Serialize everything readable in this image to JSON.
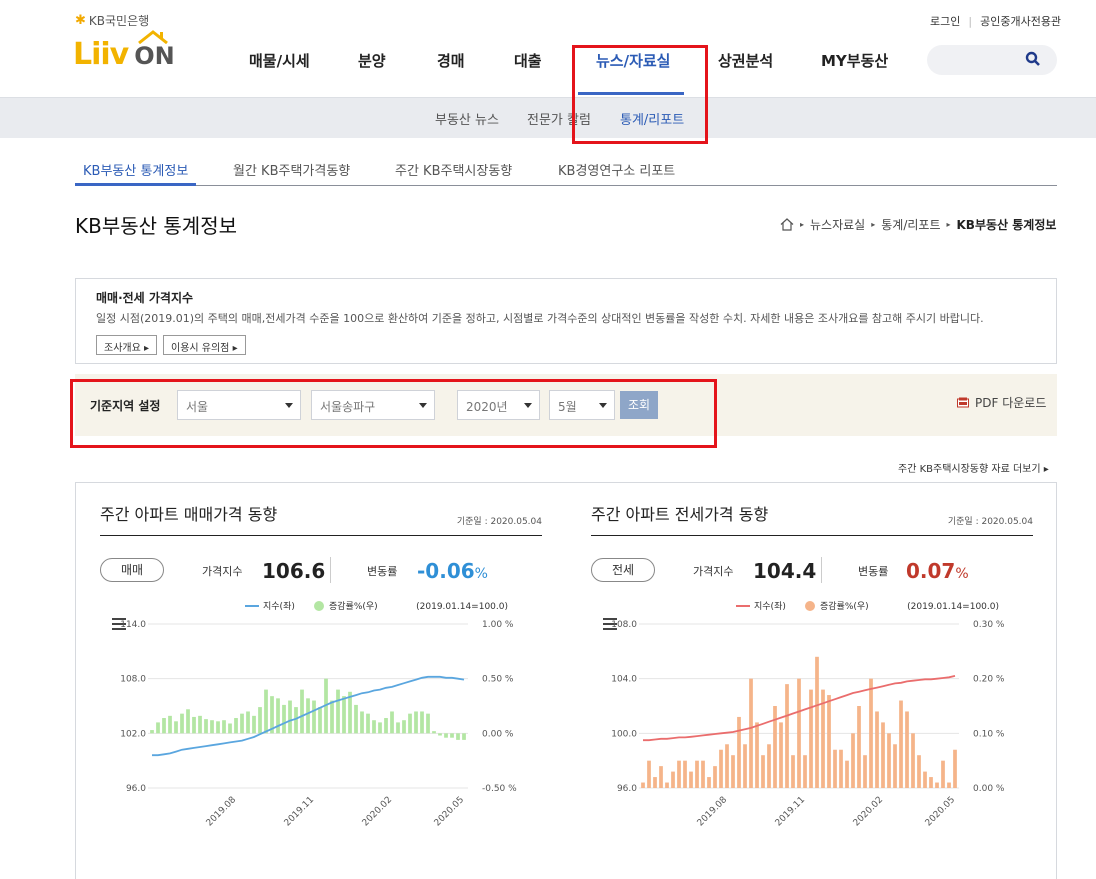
{
  "header": {
    "kb_brand": "KB국민은행",
    "logo_liiv": "Liiv",
    "logo_on": "ON",
    "login": "로그인",
    "agent_link": "공인중개사전용관",
    "nav": [
      "매물/시세",
      "분양",
      "경매",
      "대출",
      "뉴스/자료실",
      "상권분석",
      "MY부동산"
    ],
    "active_nav": "뉴스/자료실"
  },
  "subnav": {
    "items": [
      "부동산 뉴스",
      "전문가 칼럼",
      "통계/리포트"
    ],
    "active": "통계/리포트"
  },
  "tabs": {
    "items": [
      "KB부동산 통계정보",
      "월간 KB주택가격동향",
      "주간 KB주택시장동향",
      "KB경영연구소 리포트"
    ],
    "active": "KB부동산 통계정보"
  },
  "page_title": "KB부동산 통계정보",
  "breadcrumb": [
    "뉴스자료실",
    "통계/리포트",
    "KB부동산 통계정보"
  ],
  "info": {
    "title": "매매·전세 가격지수",
    "description": "일정 시점(2019.01)의 주택의 매매,전세가격 수준을 100으로 환산하여 기준을 정하고, 시점별로 가격수준의 상대적인 변동률을 작성한 수치. 자세한 내용은 조사개요를 참고해 주시기 바랍니다.",
    "btn_survey": "조사개요",
    "btn_notice": "이용시 유의점"
  },
  "filter": {
    "label": "기준지역 설정",
    "region": "서울",
    "district": "서울송파구",
    "year": "2020년",
    "month": "5월",
    "search_btn": "조회",
    "pdf": "PDF 다운로드"
  },
  "more_link": "주간 KB주택시장동향 자료 더보기",
  "colors": {
    "sale_line": "#5aa6df",
    "sale_bar": "#b3e6a3",
    "jeonse_line": "#ea6d6d",
    "jeonse_bar": "#f5b48a",
    "down": "#2f8fd6",
    "up": "#c0392b"
  },
  "sale": {
    "title": "주간 아파트 매매가격 동향",
    "date": "기준일 : 2020.05.04",
    "pill": "매매",
    "index_label": "가격지수",
    "index_value": "106.6",
    "rate_label": "변동률",
    "rate_value": "-0.06",
    "rate_unit": "%",
    "base_note": "(2019.01.14=100.0)",
    "legend_line": "지수(좌)",
    "legend_bar": "증감률%(우)"
  },
  "jeonse": {
    "title": "주간 아파트 전세가격 동향",
    "date": "기준일 : 2020.05.04",
    "pill": "전세",
    "index_label": "가격지수",
    "index_value": "104.4",
    "rate_label": "변동률",
    "rate_value": "0.07",
    "rate_unit": "%",
    "base_note": "(2019.01.14=100.0)",
    "legend_line": "지수(좌)",
    "legend_bar": "증감률%(우)"
  },
  "chart_data": [
    {
      "type": "bar+line",
      "title": "주간 아파트 매매가격 동향",
      "x_ticks": [
        "2019.08",
        "2019.11",
        "2020.02",
        "2020.05"
      ],
      "left_axis": {
        "ticks": [
          "114.0",
          "108.0",
          "102.0",
          "96.0"
        ],
        "ylim": [
          96,
          114
        ]
      },
      "right_axis": {
        "ticks": [
          "1.00 %",
          "0.50 %",
          "0.00 %",
          "-0.50 %"
        ],
        "ylim": [
          -0.5,
          1.0
        ]
      },
      "series": [
        {
          "name": "지수(좌)",
          "kind": "line",
          "values": [
            99.6,
            99.6,
            99.7,
            99.8,
            100.0,
            100.2,
            100.3,
            100.4,
            100.5,
            100.6,
            100.7,
            100.8,
            100.9,
            101.0,
            101.1,
            101.2,
            101.4,
            101.6,
            101.9,
            102.2,
            102.5,
            102.8,
            103.1,
            103.4,
            103.6,
            103.9,
            104.2,
            104.5,
            104.8,
            105.1,
            105.4,
            105.6,
            105.8,
            106.0,
            106.2,
            106.4,
            106.5,
            106.7,
            106.8,
            107.0,
            107.1,
            107.3,
            107.5,
            107.7,
            107.9,
            108.1,
            108.2,
            108.2,
            108.2,
            108.1,
            108.1,
            108.0,
            107.9
          ]
        },
        {
          "name": "증감률%(우)",
          "kind": "bar",
          "values": [
            0.03,
            0.1,
            0.14,
            0.16,
            0.11,
            0.18,
            0.22,
            0.15,
            0.16,
            0.13,
            0.12,
            0.11,
            0.12,
            0.09,
            0.14,
            0.18,
            0.2,
            0.16,
            0.24,
            0.4,
            0.34,
            0.32,
            0.26,
            0.3,
            0.24,
            0.4,
            0.32,
            0.3,
            0.24,
            0.5,
            0.3,
            0.4,
            0.34,
            0.38,
            0.26,
            0.2,
            0.18,
            0.12,
            0.1,
            0.14,
            0.2,
            0.1,
            0.12,
            0.18,
            0.2,
            0.2,
            0.18,
            0.02,
            -0.02,
            -0.04,
            -0.04,
            -0.06,
            -0.06
          ]
        }
      ]
    },
    {
      "type": "bar+line",
      "title": "주간 아파트 전세가격 동향",
      "x_ticks": [
        "2019.08",
        "2019.11",
        "2020.02",
        "2020.05"
      ],
      "left_axis": {
        "ticks": [
          "108.0",
          "104.0",
          "100.0",
          "96.0"
        ],
        "ylim": [
          96,
          108
        ]
      },
      "right_axis": {
        "ticks": [
          "0.30 %",
          "0.20 %",
          "0.10 %",
          "0.00 %"
        ],
        "ylim": [
          0,
          0.3
        ]
      },
      "series": [
        {
          "name": "지수(좌)",
          "kind": "line",
          "values": [
            99.5,
            99.5,
            99.55,
            99.6,
            99.6,
            99.65,
            99.7,
            99.7,
            99.75,
            99.8,
            99.85,
            99.9,
            99.95,
            100.0,
            100.05,
            100.1,
            100.2,
            100.3,
            100.4,
            100.55,
            100.7,
            100.85,
            101.0,
            101.15,
            101.3,
            101.45,
            101.6,
            101.75,
            101.9,
            102.05,
            102.2,
            102.35,
            102.5,
            102.65,
            102.8,
            102.95,
            103.05,
            103.15,
            103.25,
            103.35,
            103.45,
            103.55,
            103.65,
            103.7,
            103.8,
            103.85,
            103.9,
            103.95,
            103.95,
            104.0,
            104.05,
            104.1,
            104.2
          ]
        },
        {
          "name": "증감률%(우)",
          "kind": "bar",
          "values": [
            0.01,
            0.05,
            0.02,
            0.04,
            0.01,
            0.03,
            0.05,
            0.05,
            0.03,
            0.05,
            0.05,
            0.02,
            0.04,
            0.07,
            0.08,
            0.06,
            0.13,
            0.08,
            0.2,
            0.12,
            0.06,
            0.08,
            0.15,
            0.12,
            0.19,
            0.06,
            0.2,
            0.06,
            0.18,
            0.24,
            0.18,
            0.17,
            0.07,
            0.07,
            0.05,
            0.1,
            0.15,
            0.06,
            0.2,
            0.14,
            0.12,
            0.1,
            0.08,
            0.16,
            0.14,
            0.1,
            0.06,
            0.03,
            0.02,
            0.01,
            0.05,
            0.01,
            0.07
          ]
        }
      ]
    }
  ]
}
